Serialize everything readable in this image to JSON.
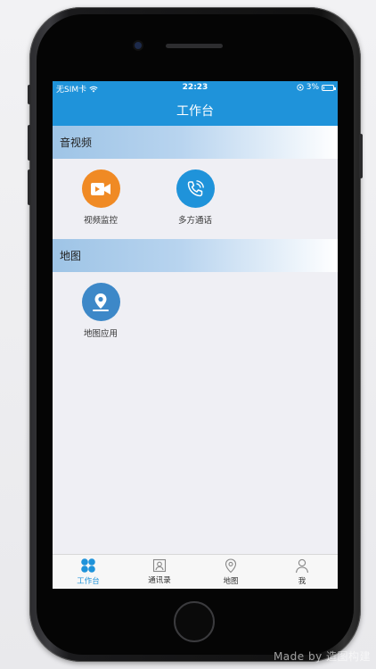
{
  "status": {
    "carrier": "无SIM卡",
    "time": "22:23",
    "battery": "3%",
    "battery_level": 0.03
  },
  "nav": {
    "title": "工作台"
  },
  "sections": [
    {
      "title": "音视频",
      "items": [
        {
          "label": "视频监控",
          "icon": "video-camera-icon",
          "color": "#f08a24"
        },
        {
          "label": "多方通话",
          "icon": "phone-call-icon",
          "color": "#1f93da"
        }
      ]
    },
    {
      "title": "地图",
      "items": [
        {
          "label": "地图应用",
          "icon": "map-pin-icon",
          "color": "#3d88c8"
        }
      ]
    }
  ],
  "tabs": [
    {
      "label": "工作台",
      "icon": "clover-grid-icon",
      "active": true
    },
    {
      "label": "通讯录",
      "icon": "contacts-icon",
      "active": false
    },
    {
      "label": "地图",
      "icon": "location-pin-icon",
      "active": false
    },
    {
      "label": "我",
      "icon": "person-icon",
      "active": false
    }
  ],
  "colors": {
    "primary": "#1f93da",
    "screen_bg": "#efeff4"
  },
  "watermark": "Made by 造图构建"
}
